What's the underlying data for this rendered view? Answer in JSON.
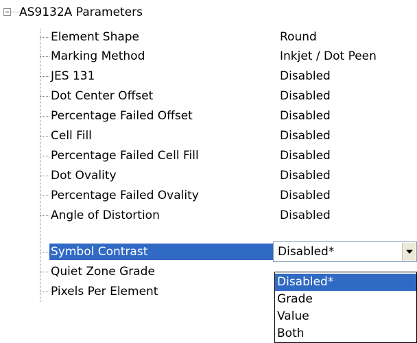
{
  "tree": {
    "root_label": "AS9132A Parameters",
    "items": [
      {
        "label": "Element Shape",
        "value": "Round"
      },
      {
        "label": "Marking Method",
        "value": "Inkjet / Dot Peen"
      },
      {
        "label": "JES 131",
        "value": "Disabled"
      },
      {
        "label": "Dot Center Offset",
        "value": "Disabled"
      },
      {
        "label": "Percentage Failed Offset",
        "value": "Disabled"
      },
      {
        "label": "Cell Fill",
        "value": "Disabled"
      },
      {
        "label": "Percentage Failed Cell Fill",
        "value": "Disabled"
      },
      {
        "label": "Dot Ovality",
        "value": "Disabled"
      },
      {
        "label": "Percentage Failed Ovality",
        "value": "Disabled"
      },
      {
        "label": "Angle of Distortion",
        "value": "Disabled"
      },
      {
        "label": "Symbol Contrast",
        "value": ""
      },
      {
        "label": "Quiet Zone Grade",
        "value": ""
      },
      {
        "label": "Pixels Per Element",
        "value": ""
      }
    ]
  },
  "combo": {
    "value": "Disabled*",
    "options": [
      "Disabled*",
      "Grade",
      "Value",
      "Both"
    ],
    "selected_option": "Disabled*"
  },
  "colors": {
    "selection": "#316ac5",
    "selection_text": "#ffffff",
    "tree_lines": "#808080"
  },
  "icons": {
    "expander": "collapse-minus-icon",
    "combo_button": "dropdown-arrow-icon"
  }
}
